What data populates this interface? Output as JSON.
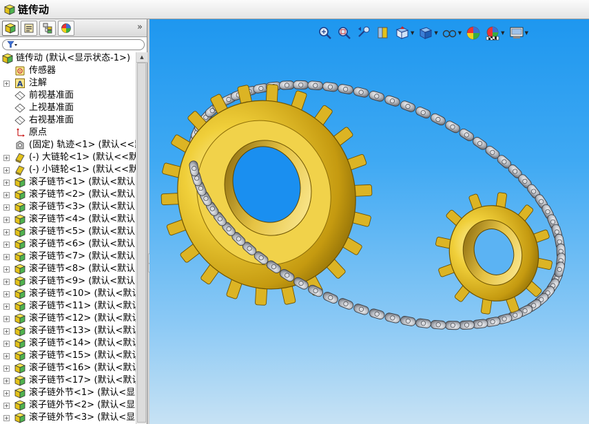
{
  "window": {
    "title": "链传动"
  },
  "panel": {
    "tabs": [
      {
        "name": "featuremanager-tab",
        "icon": "featuremanager-tree-icon"
      },
      {
        "name": "propertymanager-tab",
        "icon": "propertymanager-icon"
      },
      {
        "name": "configurationmanager-tab",
        "icon": "configurationmanager-icon"
      },
      {
        "name": "displaymanager-tab",
        "icon": "displaymanager-icon"
      }
    ],
    "more_glyph": "»",
    "filter_icon": "filter-icon"
  },
  "tree": {
    "rows": [
      {
        "label": "链传动 (默认<显示状态-1>)",
        "icon": "assembly-icon",
        "expander": "",
        "root": true
      },
      {
        "label": "传感器",
        "icon": "sensor-icon",
        "expander": ""
      },
      {
        "label": "注解",
        "icon": "annotation-icon",
        "expander": "+"
      },
      {
        "label": "前视基准面",
        "icon": "plane-icon",
        "expander": ""
      },
      {
        "label": "上视基准面",
        "icon": "plane-icon",
        "expander": ""
      },
      {
        "label": "右视基准面",
        "icon": "plane-icon",
        "expander": ""
      },
      {
        "label": "原点",
        "icon": "origin-icon",
        "expander": ""
      },
      {
        "label": "(固定) 轨迹<1> (默认<<默认",
        "icon": "fixed-part-icon",
        "expander": ""
      },
      {
        "label": "(-) 大链轮<1> (默认<<默认",
        "icon": "part-icon",
        "expander": "+"
      },
      {
        "label": "(-) 小链轮<1> (默认<<默认",
        "icon": "part-icon",
        "expander": "+"
      },
      {
        "label": "滚子链节<1> (默认<默认",
        "icon": "subassembly-icon",
        "expander": "+"
      },
      {
        "label": "滚子链节<2> (默认<默认",
        "icon": "subassembly-icon",
        "expander": "+"
      },
      {
        "label": "滚子链节<3> (默认<默认",
        "icon": "subassembly-icon",
        "expander": "+"
      },
      {
        "label": "滚子链节<4> (默认<默认",
        "icon": "subassembly-icon",
        "expander": "+"
      },
      {
        "label": "滚子链节<5> (默认<默认",
        "icon": "subassembly-icon",
        "expander": "+"
      },
      {
        "label": "滚子链节<6> (默认<默认",
        "icon": "subassembly-icon",
        "expander": "+"
      },
      {
        "label": "滚子链节<7> (默认<默认",
        "icon": "subassembly-icon",
        "expander": "+"
      },
      {
        "label": "滚子链节<8> (默认<默认",
        "icon": "subassembly-icon",
        "expander": "+"
      },
      {
        "label": "滚子链节<9> (默认<默认",
        "icon": "subassembly-icon",
        "expander": "+"
      },
      {
        "label": "滚子链节<10> (默认<默认",
        "icon": "subassembly-icon",
        "expander": "+"
      },
      {
        "label": "滚子链节<11> (默认<默认",
        "icon": "subassembly-icon",
        "expander": "+"
      },
      {
        "label": "滚子链节<12> (默认<默认",
        "icon": "subassembly-icon",
        "expander": "+"
      },
      {
        "label": "滚子链节<13> (默认<默认",
        "icon": "subassembly-icon",
        "expander": "+"
      },
      {
        "label": "滚子链节<14> (默认<默认",
        "icon": "subassembly-icon",
        "expander": "+"
      },
      {
        "label": "滚子链节<15> (默认<默认",
        "icon": "subassembly-icon",
        "expander": "+"
      },
      {
        "label": "滚子链节<16> (默认<默认",
        "icon": "subassembly-icon",
        "expander": "+"
      },
      {
        "label": "滚子链节<17> (默认<默认",
        "icon": "subassembly-icon",
        "expander": "+"
      },
      {
        "label": "滚子链外节<1> (默认<显",
        "icon": "subassembly-icon",
        "expander": "+"
      },
      {
        "label": "滚子链外节<2> (默认<显",
        "icon": "subassembly-icon",
        "expander": "+"
      },
      {
        "label": "滚子链外节<3> (默认<显",
        "icon": "subassembly-icon",
        "expander": "+"
      }
    ]
  },
  "view_toolbar": {
    "buttons": [
      {
        "name": "zoom-to-fit-button",
        "icon": "zoom-to-fit-icon",
        "dropdown": false
      },
      {
        "name": "zoom-to-area-button",
        "icon": "zoom-to-area-icon",
        "dropdown": false
      },
      {
        "name": "previous-view-button",
        "icon": "previous-view-icon",
        "dropdown": false
      },
      {
        "name": "section-view-button",
        "icon": "section-view-icon",
        "dropdown": false
      },
      {
        "name": "view-orientation-button",
        "icon": "view-orientation-icon",
        "dropdown": true
      },
      {
        "name": "display-style-button",
        "icon": "display-style-icon",
        "dropdown": true
      },
      {
        "name": "hide-show-items-button",
        "icon": "hide-show-icon",
        "dropdown": true
      },
      {
        "name": "edit-appearance-button",
        "icon": "appearance-icon",
        "dropdown": false
      },
      {
        "name": "apply-scene-button",
        "icon": "scene-icon",
        "dropdown": true
      },
      {
        "name": "view-settings-button",
        "icon": "view-settings-icon",
        "dropdown": true
      }
    ]
  },
  "colors": {
    "viewport_top": "#1e97ef",
    "viewport_bottom": "#c7e2f4",
    "sprocket_gold": "#d9b21c",
    "chain_steel": "#b8bcc2"
  }
}
